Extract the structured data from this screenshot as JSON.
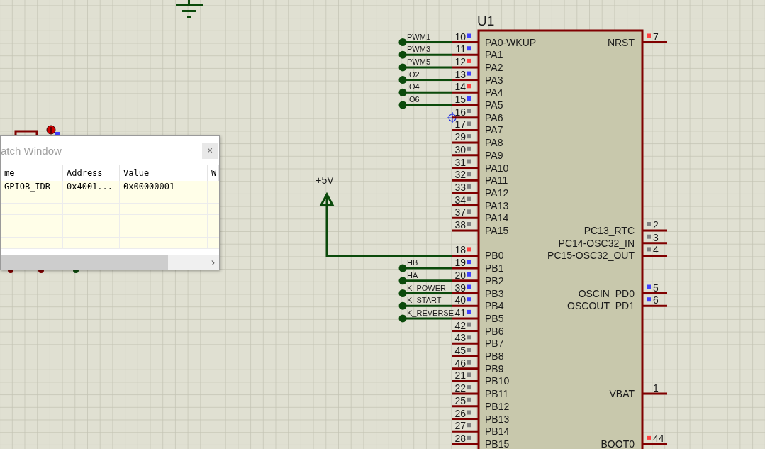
{
  "schematic": {
    "ground": {
      "kind": "ground"
    },
    "power": {
      "label": "+5V"
    },
    "chip": {
      "ref": "U1",
      "left_groups": [
        [
          {
            "number": "10",
            "name": "PA0-WKUP",
            "color": "#4040ff",
            "kind": "net",
            "net": "PWM1"
          },
          {
            "number": "11",
            "name": "PA1",
            "color": "#4040ff",
            "kind": "net",
            "net": "PWM3"
          },
          {
            "number": "12",
            "name": "PA2",
            "color": "#ff4040",
            "kind": "net",
            "net": "PWM5"
          },
          {
            "number": "13",
            "name": "PA3",
            "color": "#4040ff",
            "kind": "net",
            "net": "IO2"
          },
          {
            "number": "14",
            "name": "PA4",
            "color": "#ff4040",
            "kind": "net",
            "net": "IO4"
          },
          {
            "number": "15",
            "name": "PA5",
            "color": "#4040ff",
            "kind": "net",
            "net": "IO6"
          },
          {
            "number": "16",
            "name": "PA6",
            "color": "#808080",
            "kind": "open"
          },
          {
            "number": "17",
            "name": "PA7",
            "color": "#808080",
            "kind": "open"
          },
          {
            "number": "29",
            "name": "PA8",
            "color": "#808080",
            "kind": "open"
          },
          {
            "number": "30",
            "name": "PA9",
            "color": "#808080",
            "kind": "open"
          },
          {
            "number": "31",
            "name": "PA10",
            "color": "#808080",
            "kind": "open"
          },
          {
            "number": "32",
            "name": "PA11",
            "color": "#808080",
            "kind": "open"
          },
          {
            "number": "33",
            "name": "PA12",
            "color": "#808080",
            "kind": "open"
          },
          {
            "number": "34",
            "name": "PA13",
            "color": "#808080",
            "kind": "open"
          },
          {
            "number": "37",
            "name": "PA14",
            "color": "#808080",
            "kind": "open"
          },
          {
            "number": "38",
            "name": "PA15",
            "color": "#808080",
            "kind": "open"
          }
        ],
        [
          {
            "number": "18",
            "name": "PB0",
            "color": "#ff4040",
            "kind": "power"
          },
          {
            "number": "19",
            "name": "PB1",
            "color": "#4040ff",
            "kind": "net",
            "net": "HB"
          },
          {
            "number": "20",
            "name": "PB2",
            "color": "#4040ff",
            "kind": "net",
            "net": "HA"
          },
          {
            "number": "39",
            "name": "PB3",
            "color": "#4040ff",
            "kind": "net",
            "net": "K_POWER"
          },
          {
            "number": "40",
            "name": "PB4",
            "color": "#4040ff",
            "kind": "net",
            "net": "K_START"
          },
          {
            "number": "41",
            "name": "PB5",
            "color": "#4040ff",
            "kind": "net",
            "net": "K_REVERSE"
          },
          {
            "number": "42",
            "name": "PB6",
            "color": "#808080",
            "kind": "open"
          },
          {
            "number": "43",
            "name": "PB7",
            "color": "#808080",
            "kind": "open"
          },
          {
            "number": "45",
            "name": "PB8",
            "color": "#808080",
            "kind": "open"
          },
          {
            "number": "46",
            "name": "PB9",
            "color": "#808080",
            "kind": "open"
          },
          {
            "number": "21",
            "name": "PB10",
            "color": "#808080",
            "kind": "open"
          },
          {
            "number": "22",
            "name": "PB11",
            "color": "#808080",
            "kind": "open"
          },
          {
            "number": "25",
            "name": "PB12",
            "color": "#808080",
            "kind": "open"
          },
          {
            "number": "26",
            "name": "PB13",
            "color": "#808080",
            "kind": "open"
          },
          {
            "number": "27",
            "name": "PB14",
            "color": "#808080",
            "kind": "open"
          },
          {
            "number": "28",
            "name": "PB15",
            "color": "#808080",
            "kind": "open"
          }
        ]
      ],
      "right_pins": [
        {
          "number": "7",
          "name": "NRST",
          "color": "#ff4040"
        },
        {
          "number": "2",
          "name": "PC13_RTC",
          "color": "#808080"
        },
        {
          "number": "3",
          "name": "PC14-OSC32_IN",
          "color": "#808080"
        },
        {
          "number": "4",
          "name": "PC15-OSC32_OUT",
          "color": "#808080"
        },
        {
          "number": "5",
          "name": "OSCIN_PD0",
          "color": "#4040ff"
        },
        {
          "number": "6",
          "name": "OSCOUT_PD1",
          "color": "#4040ff"
        },
        {
          "number": "1",
          "name": "VBAT"
        },
        {
          "number": "44",
          "name": "BOOT0",
          "color": "#ff4040"
        }
      ]
    }
  },
  "watch_window": {
    "title": "atch Window",
    "close": "×",
    "columns": [
      "me",
      "Address",
      "Value",
      "W"
    ],
    "rows": [
      {
        "name": "GPIOB_IDR",
        "address": "0x4001...",
        "value": "0x00000001"
      }
    ],
    "scroll_arrow": "›"
  }
}
